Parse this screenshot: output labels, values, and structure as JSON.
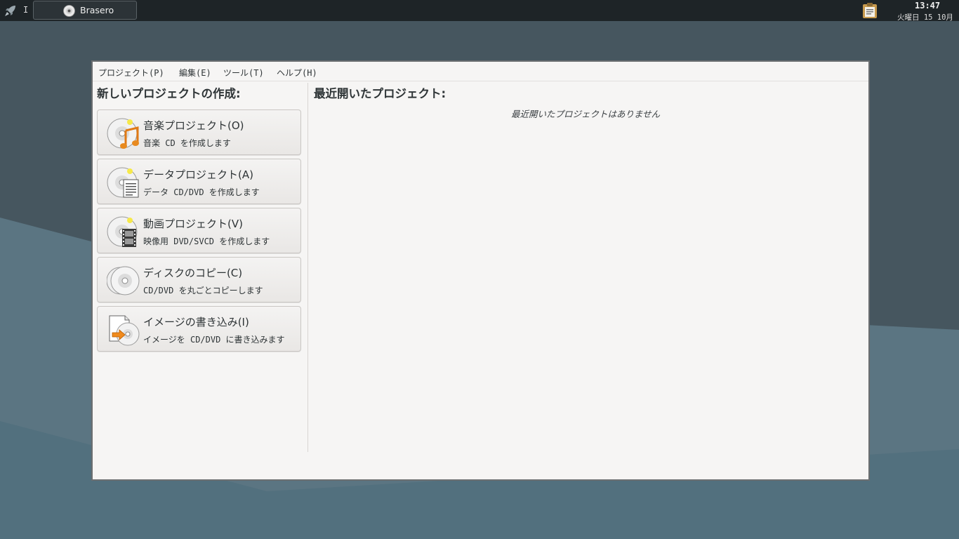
{
  "taskbar": {
    "workspace": "I",
    "app_button": "Brasero",
    "clock_time": "13:47",
    "clock_date": "火曜日 15 10月"
  },
  "menu": [
    "プロジェクト(P)",
    "編集(E)",
    "ツール(T)",
    "ヘルプ(H)"
  ],
  "new_project": {
    "heading": "新しいプロジェクトの作成:",
    "items": [
      {
        "title": "音楽プロジェクト(O)",
        "desc": "音楽 CD を作成します",
        "icon": "audio-project-icon"
      },
      {
        "title": "データプロジェクト(A)",
        "desc": "データ CD/DVD を作成します",
        "icon": "data-project-icon"
      },
      {
        "title": "動画プロジェクト(V)",
        "desc": "映像用 DVD/SVCD を作成します",
        "icon": "video-project-icon"
      },
      {
        "title": "ディスクのコピー(C)",
        "desc": "CD/DVD を丸ごとコピーします",
        "icon": "disc-copy-icon"
      },
      {
        "title": "イメージの書き込み(I)",
        "desc": "イメージを CD/DVD に書き込みます",
        "icon": "image-burn-icon"
      }
    ]
  },
  "recent": {
    "heading": "最近開いたプロジェクト:",
    "empty_message": "最近開いたプロジェクトはありません"
  }
}
